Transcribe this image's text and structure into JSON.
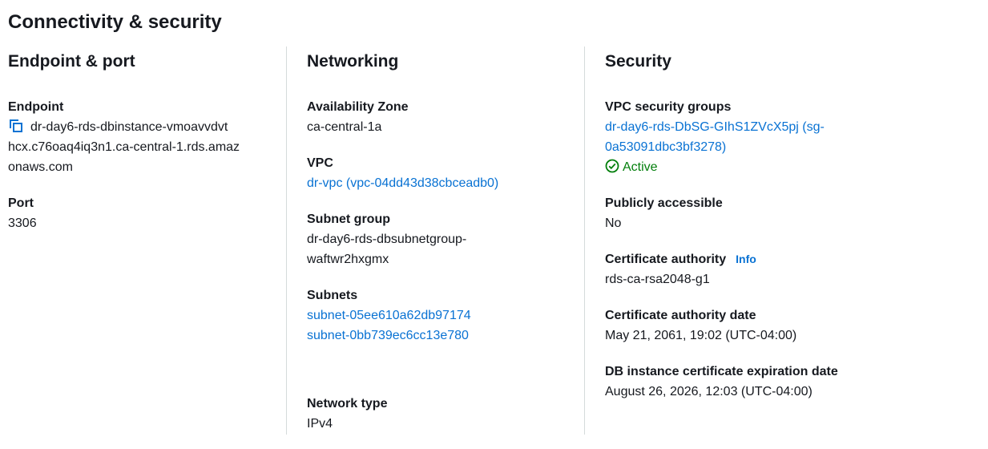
{
  "page_title": "Connectivity & security",
  "endpoint_port": {
    "heading": "Endpoint & port",
    "endpoint_label": "Endpoint",
    "endpoint_line1": "dr-day6-rds-dbinstance-vmoavvdvt",
    "endpoint_line2": "hcx.c76oaq4iq3n1.ca-central-1.rds.amaz",
    "endpoint_line3": "onaws.com",
    "port_label": "Port",
    "port_value": "3306"
  },
  "networking": {
    "heading": "Networking",
    "az_label": "Availability Zone",
    "az_value": "ca-central-1a",
    "vpc_label": "VPC",
    "vpc_value": "dr-vpc (vpc-04dd43d38cbceadb0)",
    "subnet_group_label": "Subnet group",
    "subnet_group_line1": "dr-day6-rds-dbsubnetgroup-",
    "subnet_group_line2": "waftwr2hxgmx",
    "subnets_label": "Subnets",
    "subnets": [
      "subnet-05ee610a62db97174",
      "subnet-0bb739ec6cc13e780"
    ],
    "network_type_label": "Network type",
    "network_type_value": "IPv4"
  },
  "security": {
    "heading": "Security",
    "vpc_sg_label": "VPC security groups",
    "vpc_sg_line1": "dr-day6-rds-DbSG-GIhS1ZVcX5pj (sg-",
    "vpc_sg_line2": "0a53091dbc3bf3278)",
    "vpc_sg_status": "Active",
    "public_label": "Publicly accessible",
    "public_value": "No",
    "ca_label": "Certificate authority",
    "ca_info": "Info",
    "ca_value": "rds-ca-rsa2048-g1",
    "ca_date_label": "Certificate authority date",
    "ca_date_value": "May 21, 2061, 19:02 (UTC-04:00)",
    "db_cert_exp_label": "DB instance certificate expiration date",
    "db_cert_exp_value": "August 26, 2026, 12:03 (UTC-04:00)"
  },
  "colors": {
    "link": "#0972d3",
    "success": "#037f0c",
    "text": "#16191f",
    "divider": "#d5dbdb"
  },
  "icons": {
    "copy": "copy-icon",
    "status": "status-positive-icon"
  }
}
